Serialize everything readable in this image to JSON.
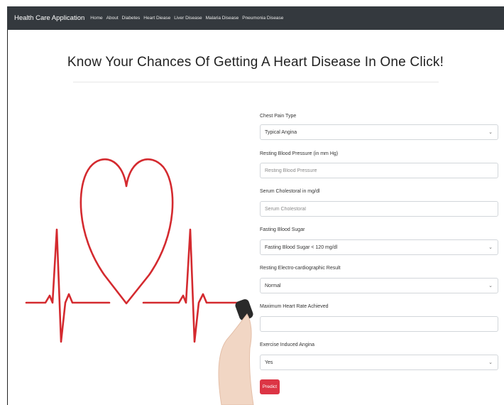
{
  "navbar": {
    "brand": "Health Care Application",
    "items": [
      {
        "label": "Home"
      },
      {
        "label": "About"
      },
      {
        "label": "Diabetes"
      },
      {
        "label": "Heart Diease"
      },
      {
        "label": "Liver Disease"
      },
      {
        "label": "Malaria Disease"
      },
      {
        "label": "Pneumonia Disease"
      }
    ],
    "bg_color": "#34393e"
  },
  "page": {
    "title": "Know Your Chances Of Getting A Heart Disease In One Click!"
  },
  "form": {
    "chest_pain": {
      "label": "Chest Pain Type",
      "value": "Typical Angina"
    },
    "resting_bp": {
      "label": "Resting Blood Pressure (in mm Hg)",
      "placeholder": "Resting Blood Pressure",
      "value": ""
    },
    "cholesterol": {
      "label": "Serum Cholestoral in mg/dl",
      "placeholder": "Serum Cholestoral",
      "value": ""
    },
    "fasting_sugar": {
      "label": "Fasting Blood Sugar",
      "value": "Fasting Blood Sugar < 120 mg/dl"
    },
    "ecg": {
      "label": "Resting Electro-cardiographic Result",
      "value": "Normal"
    },
    "max_heart_rate": {
      "label": "Maximum Heart Rate Achieved",
      "placeholder": "",
      "value": ""
    },
    "angina": {
      "label": "Exercise Induced Angina",
      "value": "Yes"
    },
    "predict_label": "Predict",
    "accent_color": "#dc3545"
  },
  "icons": {
    "select_arrow": "chevron-down-icon",
    "illustration": "heartbeat-heart-illustration"
  }
}
